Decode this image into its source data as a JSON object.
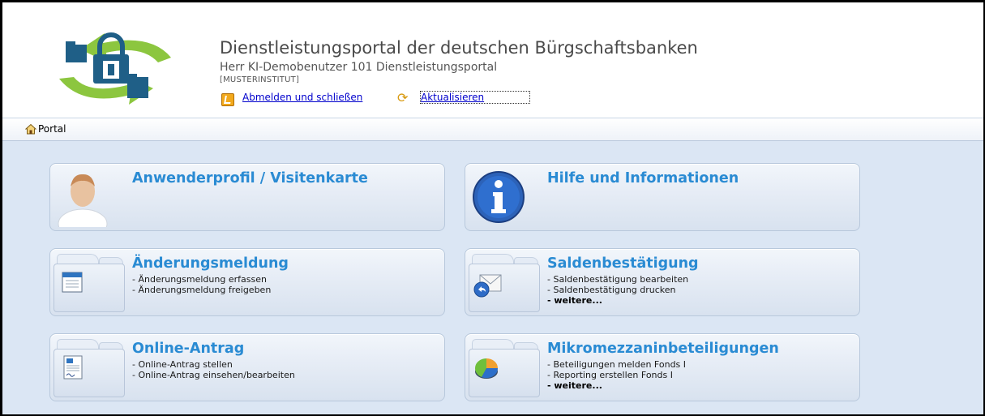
{
  "header": {
    "title": "Dienstleistungsportal der deutschen Bürgschaftsbanken",
    "subtitle": "Herr KI-Demobenutzer 101 Dienstleistungsportal",
    "institute": "[MUSTERINSTITUT]",
    "logout_label": "Abmelden und schließen",
    "refresh_label": "Aktualisieren"
  },
  "breadcrumb": {
    "label": "Portal"
  },
  "tiles": [
    {
      "title": "Anwenderprofil / Visitenkarte",
      "lines": [],
      "icon": "user-profile-icon"
    },
    {
      "title": "Hilfe und Informationen",
      "lines": [],
      "icon": "info-icon"
    },
    {
      "title": "Änderungsmeldung",
      "lines": [
        "- Änderungsmeldung erfassen",
        "- Änderungsmeldung freigeben"
      ],
      "icon": "notepad-icon"
    },
    {
      "title": "Saldenbestätigung",
      "lines": [
        "- Saldenbestätigung bearbeiten",
        "- Saldenbestätigung drucken"
      ],
      "more": "- weitere...",
      "icon": "mail-reply-icon"
    },
    {
      "title": "Online-Antrag",
      "lines": [
        "- Online-Antrag stellen",
        "- Online-Antrag einsehen/bearbeiten"
      ],
      "icon": "document-icon"
    },
    {
      "title": "Mikromezzaninbeteiligungen",
      "lines": [
        "- Beteiligungen melden Fonds I",
        "- Reporting erstellen Fonds I"
      ],
      "more": "- weitere...",
      "icon": "pie-chart-icon"
    }
  ],
  "colors": {
    "tile_title": "#2a8bd3",
    "background": "#dbe6f4",
    "logo_blue": "#1f5f87",
    "logo_green": "#8cc63f",
    "link": "#0000cc"
  }
}
